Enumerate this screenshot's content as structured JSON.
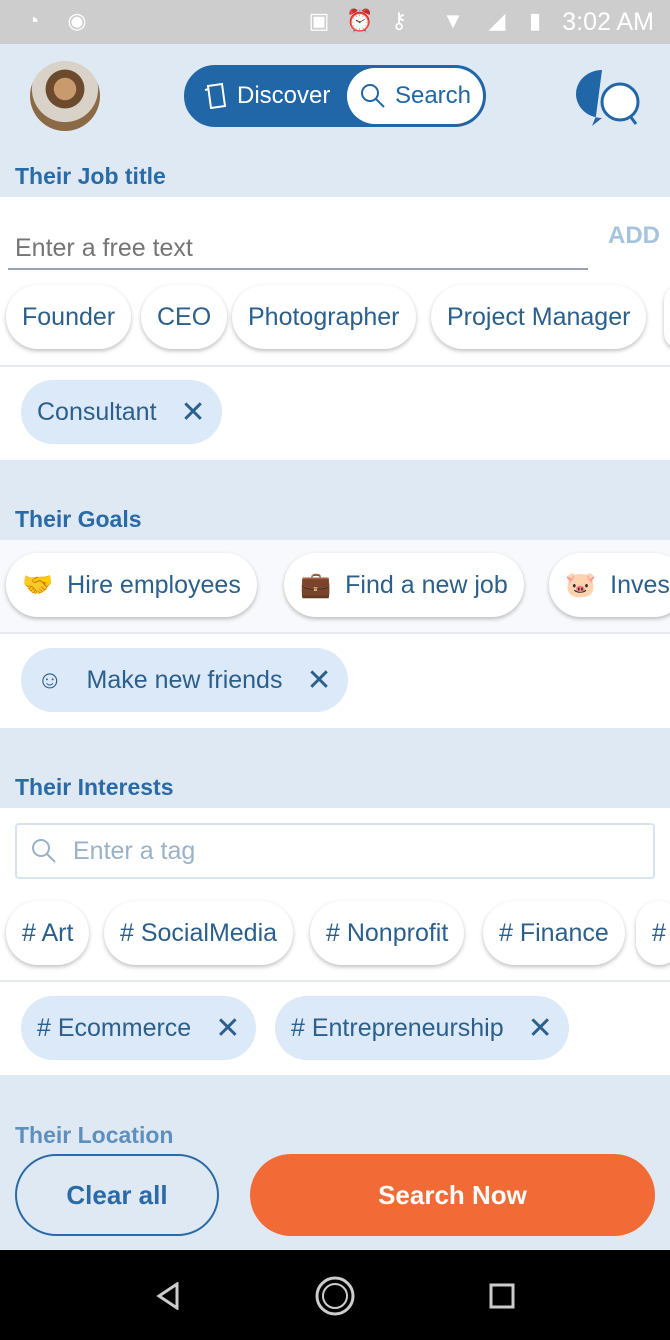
{
  "status": {
    "time": "3:02 AM"
  },
  "header": {
    "discover": "Discover",
    "search": "Search"
  },
  "job": {
    "title": "Their Job title",
    "placeholder": "Enter a free text",
    "add": "ADD",
    "suggestions": [
      "Founder",
      "CEO",
      "Photographer",
      "Project Manager"
    ],
    "selected": [
      "Consultant"
    ]
  },
  "goals": {
    "title": "Their Goals",
    "suggestions": [
      {
        "label": "Hire employees",
        "icon": "handshake-icon"
      },
      {
        "label": "Find a new job",
        "icon": "briefcase-icon"
      },
      {
        "label": "Inves",
        "icon": "piggy-bank-icon"
      }
    ],
    "selected": [
      {
        "label": "Make new friends",
        "icon": "friends-icon"
      }
    ]
  },
  "interests": {
    "title": "Their Interests",
    "placeholder": "Enter a tag",
    "suggestions": [
      "# Art",
      "# SocialMedia",
      "# Nonprofit",
      "# Finance",
      "#"
    ],
    "selected": [
      "# Ecommerce",
      "# Entrepreneurship"
    ]
  },
  "location": {
    "title": "Their Location"
  },
  "actions": {
    "clear": "Clear all",
    "search": "Search Now"
  },
  "colors": {
    "primary": "#2166a6",
    "accent": "#f26a35",
    "chip_selected": "#dce9f8"
  }
}
